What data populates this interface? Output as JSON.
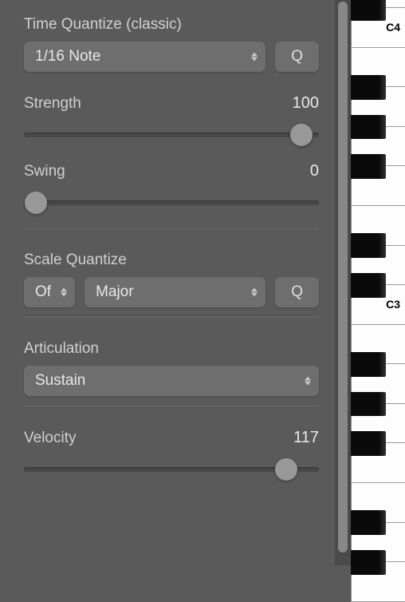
{
  "timeQuantize": {
    "label": "Time Quantize (classic)",
    "value": "1/16 Note",
    "qButton": "Q"
  },
  "strength": {
    "label": "Strength",
    "value": "100",
    "sliderPercent": 94
  },
  "swing": {
    "label": "Swing",
    "value": "0",
    "sliderPercent": 4
  },
  "scaleQuantize": {
    "label": "Scale Quantize",
    "root": "Of",
    "scale": "Major",
    "qButton": "Q"
  },
  "articulation": {
    "label": "Articulation",
    "value": "Sustain"
  },
  "velocity": {
    "label": "Velocity",
    "value": "117",
    "sliderPercent": 89
  },
  "piano": {
    "labelC4": "C4",
    "labelC3": "C3"
  }
}
